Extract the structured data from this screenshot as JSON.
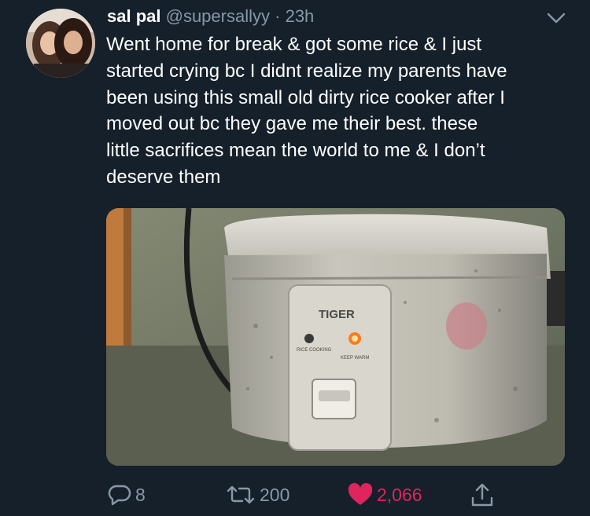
{
  "tweet": {
    "display_name": "sal pal",
    "handle": "@supersallyy",
    "separator": "·",
    "time": "23h",
    "text": "Went home for break & got some rice & I just\nstarted crying bc I didnt realize my parents have\nbeen using this small old dirty rice cooker after I\nmoved out bc they gave me their best. these\nlittle sacrifices mean the world to me & I don’t\ndeserve them"
  },
  "media": {
    "brand_text": "TIGER",
    "label_left": "RICE COOKING",
    "label_right": "KEEP WARM"
  },
  "actions": {
    "reply_count": "8",
    "retweet_count": "200",
    "like_count": "2,066"
  },
  "colors": {
    "background": "#15202b",
    "secondary_text": "#8899a6",
    "like": "#e0245e"
  },
  "icons": [
    "chevron-down-icon",
    "reply-icon",
    "retweet-icon",
    "heart-icon",
    "share-icon"
  ]
}
